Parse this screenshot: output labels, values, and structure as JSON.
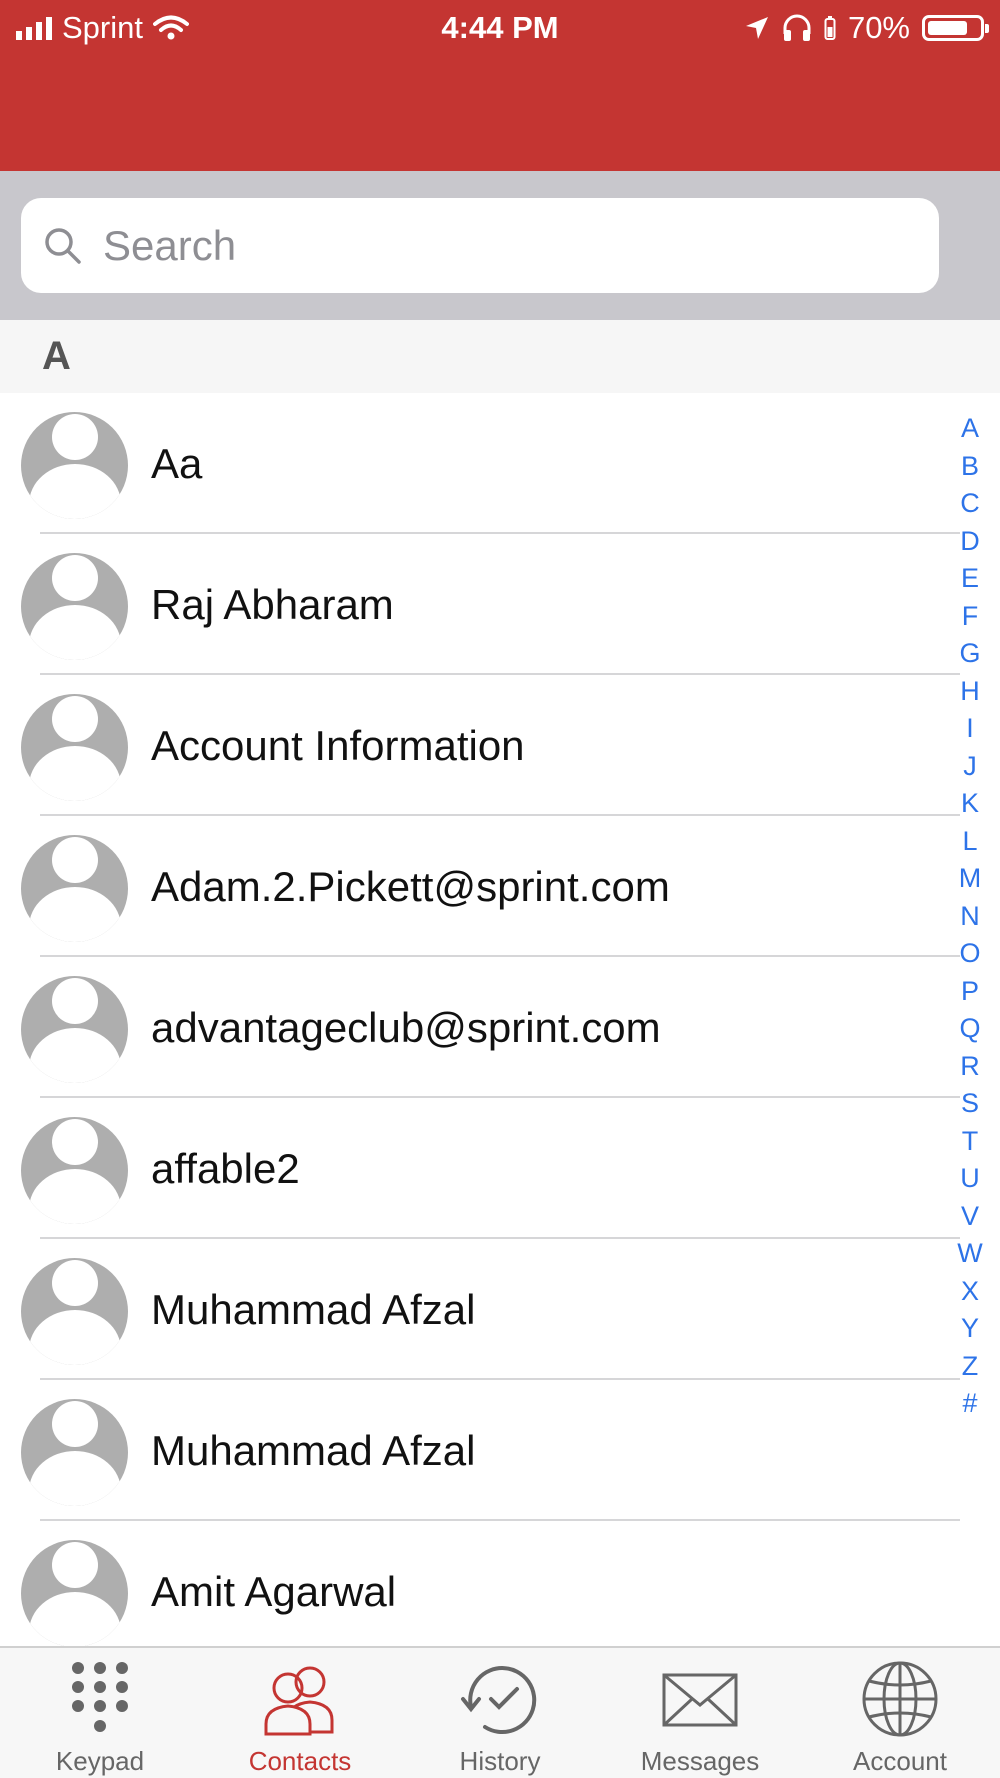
{
  "status_bar": {
    "carrier": "Sprint",
    "time": "4:44 PM",
    "battery": "70%",
    "battery_level": 0.7
  },
  "colors": {
    "header": "#c43532",
    "accent": "#c43532",
    "index_blue": "#2d73e8"
  },
  "search": {
    "placeholder": "Search"
  },
  "section": {
    "letter": "A"
  },
  "contacts": [
    {
      "name": "Aa"
    },
    {
      "name": "Raj Abharam"
    },
    {
      "name": "Account Information"
    },
    {
      "name": "Adam.2.Pickett@sprint.com"
    },
    {
      "name": "advantageclub@sprint.com"
    },
    {
      "name": "affable2"
    },
    {
      "name": "Muhammad Afzal"
    },
    {
      "name": "Muhammad Afzal"
    },
    {
      "name": "Amit Agarwal"
    }
  ],
  "alpha_index": [
    "A",
    "B",
    "C",
    "D",
    "E",
    "F",
    "G",
    "H",
    "I",
    "J",
    "K",
    "L",
    "M",
    "N",
    "O",
    "P",
    "Q",
    "R",
    "S",
    "T",
    "U",
    "V",
    "W",
    "X",
    "Y",
    "Z",
    "#"
  ],
  "tabs": [
    {
      "label": "Keypad",
      "icon": "keypad-icon",
      "active": false
    },
    {
      "label": "Contacts",
      "icon": "contacts-icon",
      "active": true
    },
    {
      "label": "History",
      "icon": "history-icon",
      "active": false
    },
    {
      "label": "Messages",
      "icon": "messages-icon",
      "active": false
    },
    {
      "label": "Account",
      "icon": "account-globe-icon",
      "active": false
    }
  ]
}
